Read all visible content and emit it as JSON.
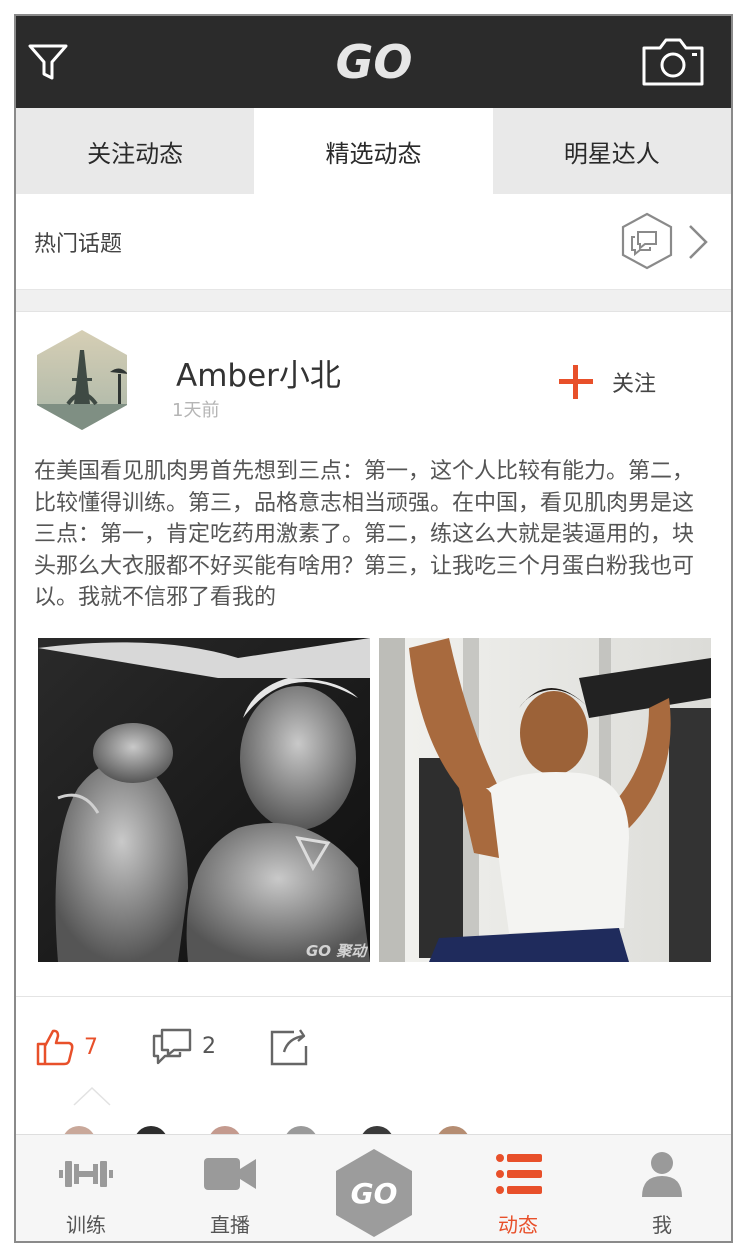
{
  "app": {
    "logo_text": "GO",
    "accent": "#e8502a",
    "topbar_bg": "#2b2b2b"
  },
  "topbar": {
    "left_icon": "filter-icon",
    "right_icon": "camera-icon"
  },
  "tabs": [
    {
      "label": "关注动态",
      "active": false
    },
    {
      "label": "精选动态",
      "active": true
    },
    {
      "label": "明星达人",
      "active": false
    }
  ],
  "hot_topics": {
    "label": "热门话题",
    "icon": "chat-bubbles-icon",
    "arrow": "chevron-right-icon"
  },
  "post": {
    "username": "Amber小北",
    "time": "1天前",
    "follow_label": "关注",
    "text": "在美国看见肌肉男首先想到三点：第一，这个人比较有能力。第二，比较懂得训练。第三，品格意志相当顽强。在中国，看见肌肉男是这三点：第一，肯定吃药用激素了。第二，练这么大就是装逼用的，块头那么大衣服都不好买能有啥用？第三，让我吃三个月蛋白粉我也可以。我就不信邪了看我的",
    "photo_watermark": "GO 聚动",
    "likes": "7",
    "comments": "2"
  },
  "bottom_nav": [
    {
      "label": "训练",
      "icon": "dumbbell-icon",
      "active": false
    },
    {
      "label": "直播",
      "icon": "video-camera-icon",
      "active": false
    },
    {
      "label": "",
      "icon": "go-logo-icon",
      "active": false
    },
    {
      "label": "动态",
      "icon": "list-icon",
      "active": true
    },
    {
      "label": "我",
      "icon": "person-icon",
      "active": false
    }
  ]
}
